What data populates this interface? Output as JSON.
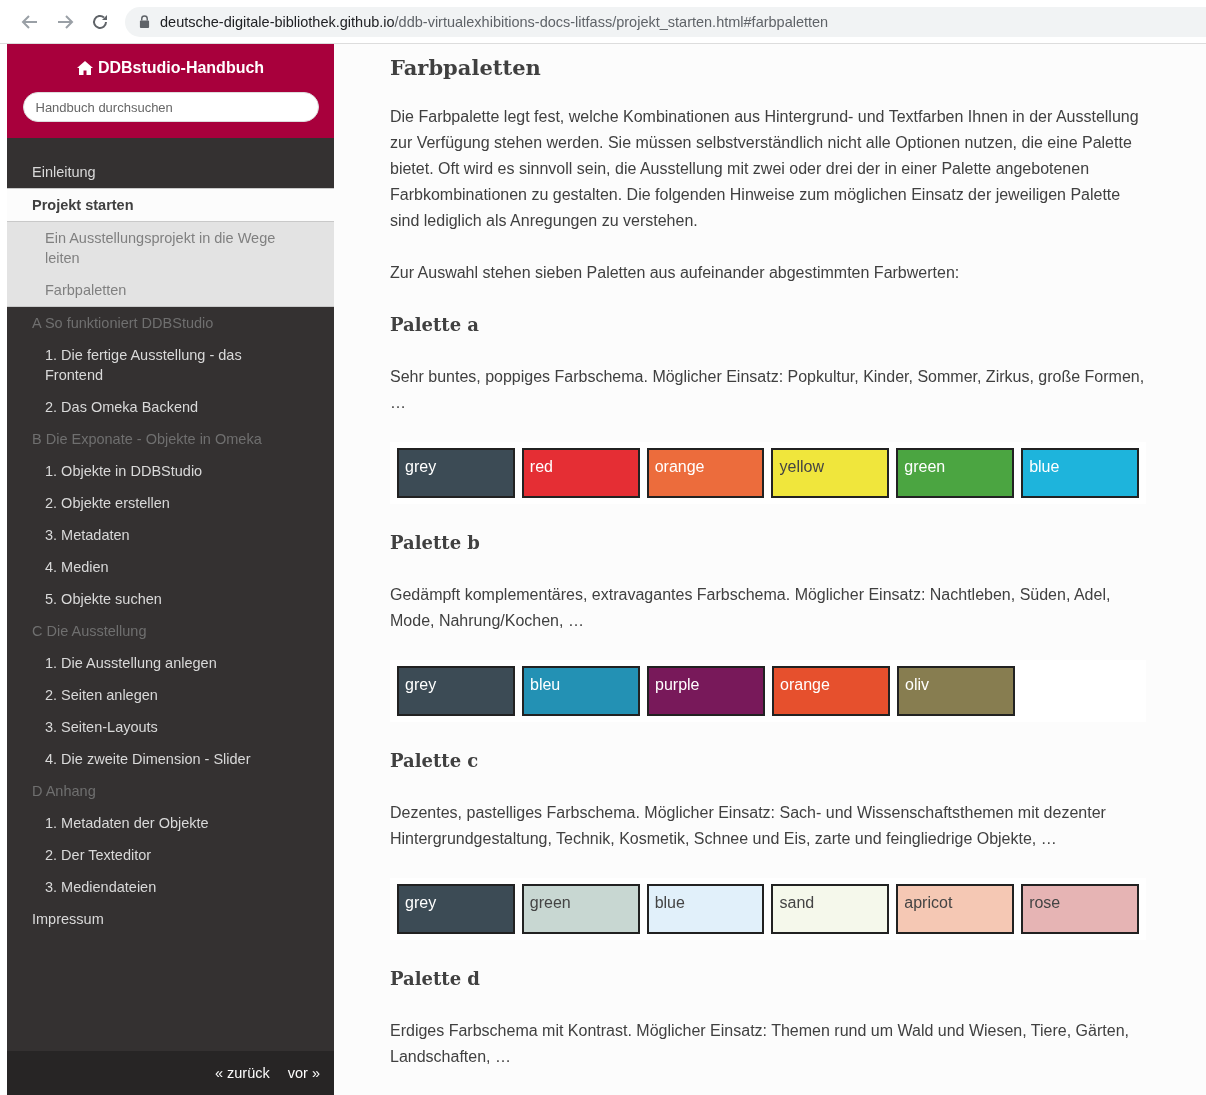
{
  "browser": {
    "url_host": "deutsche-digitale-bibliothek.github.io",
    "url_path": "/ddb-virtualexhibitions-docs-litfass/projekt_starten.html#farbpaletten"
  },
  "sidebar": {
    "title": "DDBstudio-Handbuch",
    "search": {
      "placeholder": "Handbuch durchsuchen"
    },
    "items": [
      {
        "label": "Einleitung",
        "kind": "link",
        "selected": false
      },
      {
        "label": "Projekt starten",
        "kind": "link",
        "selected": true,
        "children": [
          {
            "label": "Ein Ausstellungsprojekt in die Wege leiten",
            "selected": false
          },
          {
            "label": "Farbpaletten",
            "selected": false
          }
        ]
      },
      {
        "label": "A So funktioniert DDBStudio",
        "kind": "caption",
        "children": [
          {
            "label": "1. Die fertige Ausstellung - das Frontend",
            "selected": false
          },
          {
            "label": "2. Das Omeka Backend",
            "selected": false
          }
        ]
      },
      {
        "label": "B Die Exponate - Objekte in Omeka",
        "kind": "caption",
        "children": [
          {
            "label": "1. Objekte in DDBStudio",
            "selected": false
          },
          {
            "label": "2. Objekte erstellen",
            "selected": false
          },
          {
            "label": "3. Metadaten",
            "selected": false
          },
          {
            "label": "4. Medien",
            "selected": false
          },
          {
            "label": "5. Objekte suchen",
            "selected": false
          }
        ]
      },
      {
        "label": "C Die Ausstellung",
        "kind": "caption",
        "children": [
          {
            "label": "1. Die Ausstellung anlegen",
            "selected": false
          },
          {
            "label": "2. Seiten anlegen",
            "selected": false
          },
          {
            "label": "3. Seiten-Layouts",
            "selected": false
          },
          {
            "label": "4. Die zweite Dimension - Slider",
            "selected": false
          }
        ]
      },
      {
        "label": "D Anhang",
        "kind": "caption",
        "children": [
          {
            "label": "1. Metadaten der Objekte",
            "selected": false
          },
          {
            "label": "2. Der Texteditor",
            "selected": false
          },
          {
            "label": "3. Mediendateien",
            "selected": false
          }
        ]
      },
      {
        "label": "Impressum",
        "kind": "link",
        "selected": false
      }
    ],
    "footer": {
      "prev": "« zurück",
      "next": "vor »"
    }
  },
  "content": {
    "title": "Farbpaletten",
    "paragraphs": [
      "Die Farbpalette legt fest, welche Kombinationen aus Hintergrund- und Textfarben Ihnen in der Ausstellung zur Verfügung stehen werden. Sie müssen selbstverständlich nicht alle Optionen nutzen, die eine Palette bietet. Oft wird es sinnvoll sein, die Ausstellung mit zwei oder drei der in einer Palette angebotenen Farbkombinationen zu gestalten. Die folgenden Hinweise zum möglichen Einsatz der jeweiligen Palette sind lediglich als Anregungen zu verstehen.",
      "Zur Auswahl stehen sieben Paletten aus aufeinander abgestimmten Farbwerten:"
    ],
    "palettes": [
      {
        "title": "Palette a",
        "description": "Sehr buntes, poppiges Farbschema. Möglicher Einsatz: Popkultur, Kinder, Sommer, Zirkus, große Formen, …",
        "swatches": [
          {
            "label": "grey",
            "color": "#3c4b55"
          },
          {
            "label": "red",
            "color": "#e52e34"
          },
          {
            "label": "orange",
            "color": "#ec6c3c"
          },
          {
            "label": "yellow",
            "color": "#f0e63c"
          },
          {
            "label": "green",
            "color": "#4ba541"
          },
          {
            "label": "blue",
            "color": "#1eb4dc"
          }
        ]
      },
      {
        "title": "Palette b",
        "description": "Gedämpft komplementäres, extravagantes Farbschema. Möglicher Einsatz: Nachtleben, Süden, Adel, Mode, Nahrung/Kochen, …",
        "swatches": [
          {
            "label": "grey",
            "color": "#3c4b55"
          },
          {
            "label": "bleu",
            "color": "#2391b4"
          },
          {
            "label": "purple",
            "color": "#78195a"
          },
          {
            "label": "orange",
            "color": "#e6502d"
          },
          {
            "label": "oliv",
            "color": "#877d50"
          }
        ]
      },
      {
        "title": "Palette c",
        "description": "Dezentes, pastelliges Farbschema. Möglicher Einsatz: Sach- und Wissenschaftsthemen mit dezenter Hintergrundgestaltung, Technik, Kosmetik, Schnee und Eis, zarte und feingliedrige Objekte, …",
        "swatches": [
          {
            "label": "grey",
            "color": "#3c4b55"
          },
          {
            "label": "green",
            "color": "#c8d7d2"
          },
          {
            "label": "blue",
            "color": "#e1f0fa"
          },
          {
            "label": "sand",
            "color": "#f5f8eb"
          },
          {
            "label": "apricot",
            "color": "#f5c8b4"
          },
          {
            "label": "rose",
            "color": "#e6b4b4"
          }
        ]
      },
      {
        "title": "Palette d",
        "description": "Erdiges Farbschema mit Kontrast. Möglicher Einsatz: Themen rund um Wald und Wiesen, Tiere, Gärten, Landschaften, …"
      }
    ]
  }
}
